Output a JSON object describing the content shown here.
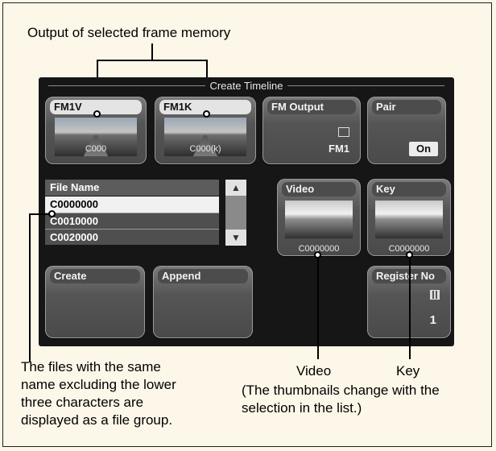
{
  "callouts": {
    "top": "Output of selected frame memory",
    "file_group": [
      "The files with the same",
      "name excluding the lower",
      "three characters are",
      "displayed as a file group."
    ],
    "video": "Video",
    "key": "Key",
    "thumb_note": [
      "(The thumbnails change with the",
      "selection in the list.)"
    ]
  },
  "panel": {
    "title": "Create Timeline",
    "fm1v": {
      "label": "FM1V",
      "thumb": "C000"
    },
    "fm1k": {
      "label": "FM1K",
      "thumb": "C000(k)"
    },
    "fm_output": {
      "label": "FM Output",
      "value": "FM1"
    },
    "pair": {
      "label": "Pair",
      "value": "On"
    },
    "list": {
      "header": "File Name",
      "rows": [
        "C0000000",
        "C0010000",
        "C0020000"
      ],
      "selected_index": 0
    },
    "video": {
      "label": "Video",
      "thumb": "C0000000"
    },
    "key": {
      "label": "Key",
      "thumb": "C0000000"
    },
    "create": {
      "label": "Create"
    },
    "append": {
      "label": "Append"
    },
    "register_no": {
      "label": "Register No",
      "value": "1"
    }
  },
  "icons": [
    "fm-output-icon",
    "keypad-icon",
    "scroll-up-icon",
    "scroll-down-icon"
  ]
}
